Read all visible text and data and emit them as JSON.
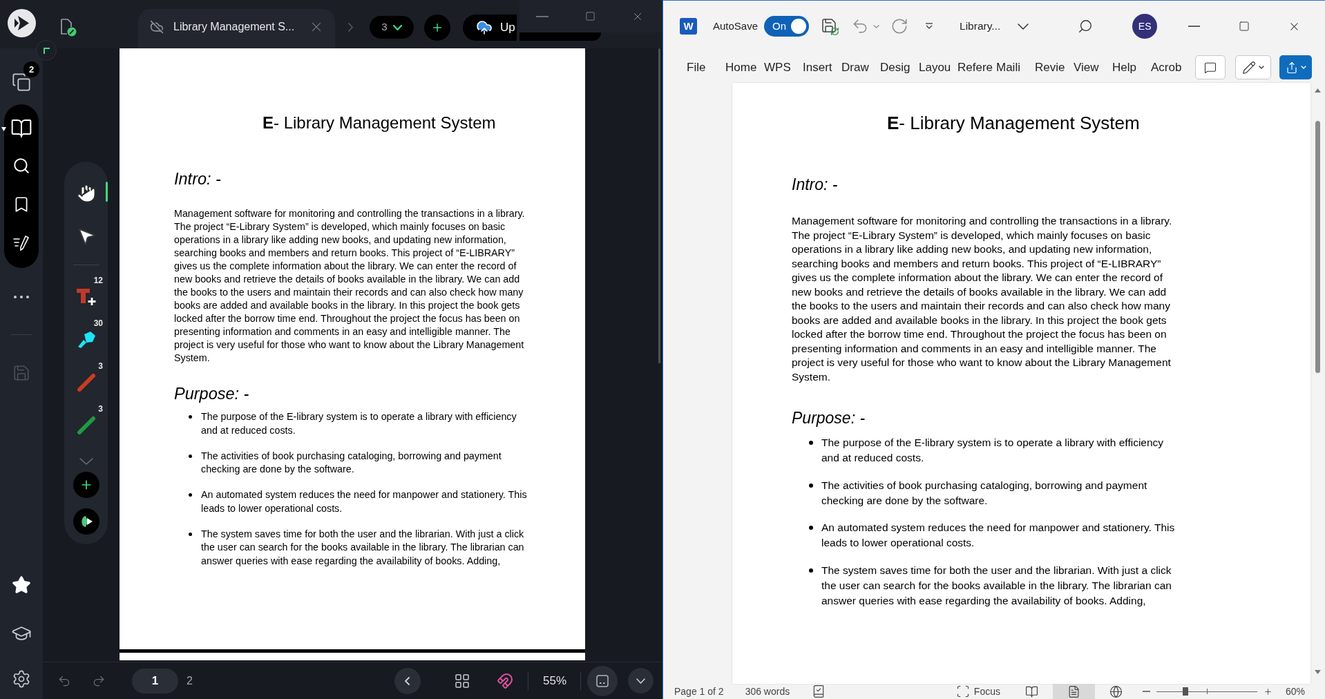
{
  "pdf_viewer": {
    "tab": {
      "title": "Library Management S..."
    },
    "open_tabs_count": "3",
    "upload_button": {
      "label": "Up"
    },
    "sidebar": {
      "pages_badge": "2"
    },
    "tools": [
      {
        "kind": "hand",
        "selected": true
      },
      {
        "kind": "pointer",
        "selected": false
      },
      {
        "kind": "text",
        "selected": false,
        "count": "12",
        "color": "#c0392b"
      },
      {
        "kind": "highlighter",
        "selected": false,
        "count": "30",
        "color": "#1ee3f5"
      },
      {
        "kind": "pen",
        "selected": false,
        "count": "3",
        "color": "#c63d22"
      },
      {
        "kind": "pen",
        "selected": false,
        "count": "3",
        "color": "#1f9a45"
      }
    ],
    "document": {
      "title": "**E**- Library Management System",
      "intro_heading": "Intro: -",
      "intro_text": "Management software for monitoring and controlling the transactions in a library. The project “E-Library System” is developed, which mainly focuses on basic operations in a library like adding new books, and updating new information, searching books and members and return books. This project of “E-LIBRARY” gives us the complete information about the library. We can enter the record of new books and retrieve the details of books available in the library. We can add the books to the users and maintain their records and can also check how many books are added and available books in the library. In this project the book gets locked after the borrow time end. Throughout the project the focus has been on presenting information and comments in an easy and intelligible manner. The project is very useful for those who want to know about the Library Management System.",
      "purpose_heading": "Purpose: -",
      "purpose_bullets": [
        "The purpose of the E-library system is to operate a library with efficiency and at reduced costs.",
        "The activities of book purchasing cataloging, borrowing and payment checking are done by the software.",
        "An automated system reduces the need for manpower and stationery. This leads to lower operational costs.",
        "The system saves time for both the user and the librarian. With just a click the user can search for the books available in the library. The librarian can answer queries with ease regarding the availability of books. Adding,"
      ]
    },
    "pages": [
      {
        "label": "1",
        "selected": true
      },
      {
        "label": "2",
        "selected": false
      }
    ],
    "zoom": "55%"
  },
  "word": {
    "logo_letter": "W",
    "autosave": {
      "label": "AutoSave",
      "state": "On",
      "on": true
    },
    "document_name": "Library...",
    "user_initials": "ES",
    "ribbon_tabs": [
      "File",
      "Home",
      "WPS",
      "Insert",
      "Draw",
      "Desig",
      "Layou",
      "Refere",
      "Maili",
      "Revie",
      "View",
      "Help",
      "Acrob"
    ],
    "document": {
      "title": "**E**- Library Management System",
      "intro_heading": "Intro: -",
      "intro_text": "Management software for monitoring and controlling the transactions in a library. The project “E-Library System” is developed, which mainly focuses on basic operations in a library like adding new books, and updating new information, searching books and members and return books. This project of “E-LIBRARY” gives us the complete information about the library. We can enter the record of new books and retrieve the details of books available in the library. We can add the books to the users and maintain their records and can also check how many books are added and available books in the library. In this project the book gets locked after the borrow time end. Throughout the project the focus has been on presenting information and comments in an easy and intelligible manner. The project is very useful for those who want to know about the Library Management System.",
      "purpose_heading": "Purpose: -",
      "purpose_bullets": [
        "The purpose of the E-library system is to operate a library with efficiency and at reduced costs.",
        "The activities of book purchasing cataloging, borrowing and payment checking are done by the software.",
        "An automated system reduces the need for manpower and stationery. This leads to lower operational costs.",
        "The system saves time for both the user and the librarian. With just a click the user can search for the books available in the library. The librarian can answer queries with ease regarding the availability of books. Adding,"
      ]
    },
    "status_bar": {
      "page": "Page 1 of 2",
      "words": "306 words",
      "focus": "Focus",
      "views": [
        {
          "kind": "read",
          "selected": false
        },
        {
          "kind": "print",
          "selected": true
        },
        {
          "kind": "web",
          "selected": false
        }
      ],
      "zoom": {
        "level": 0.29,
        "reading": "60%"
      }
    }
  }
}
